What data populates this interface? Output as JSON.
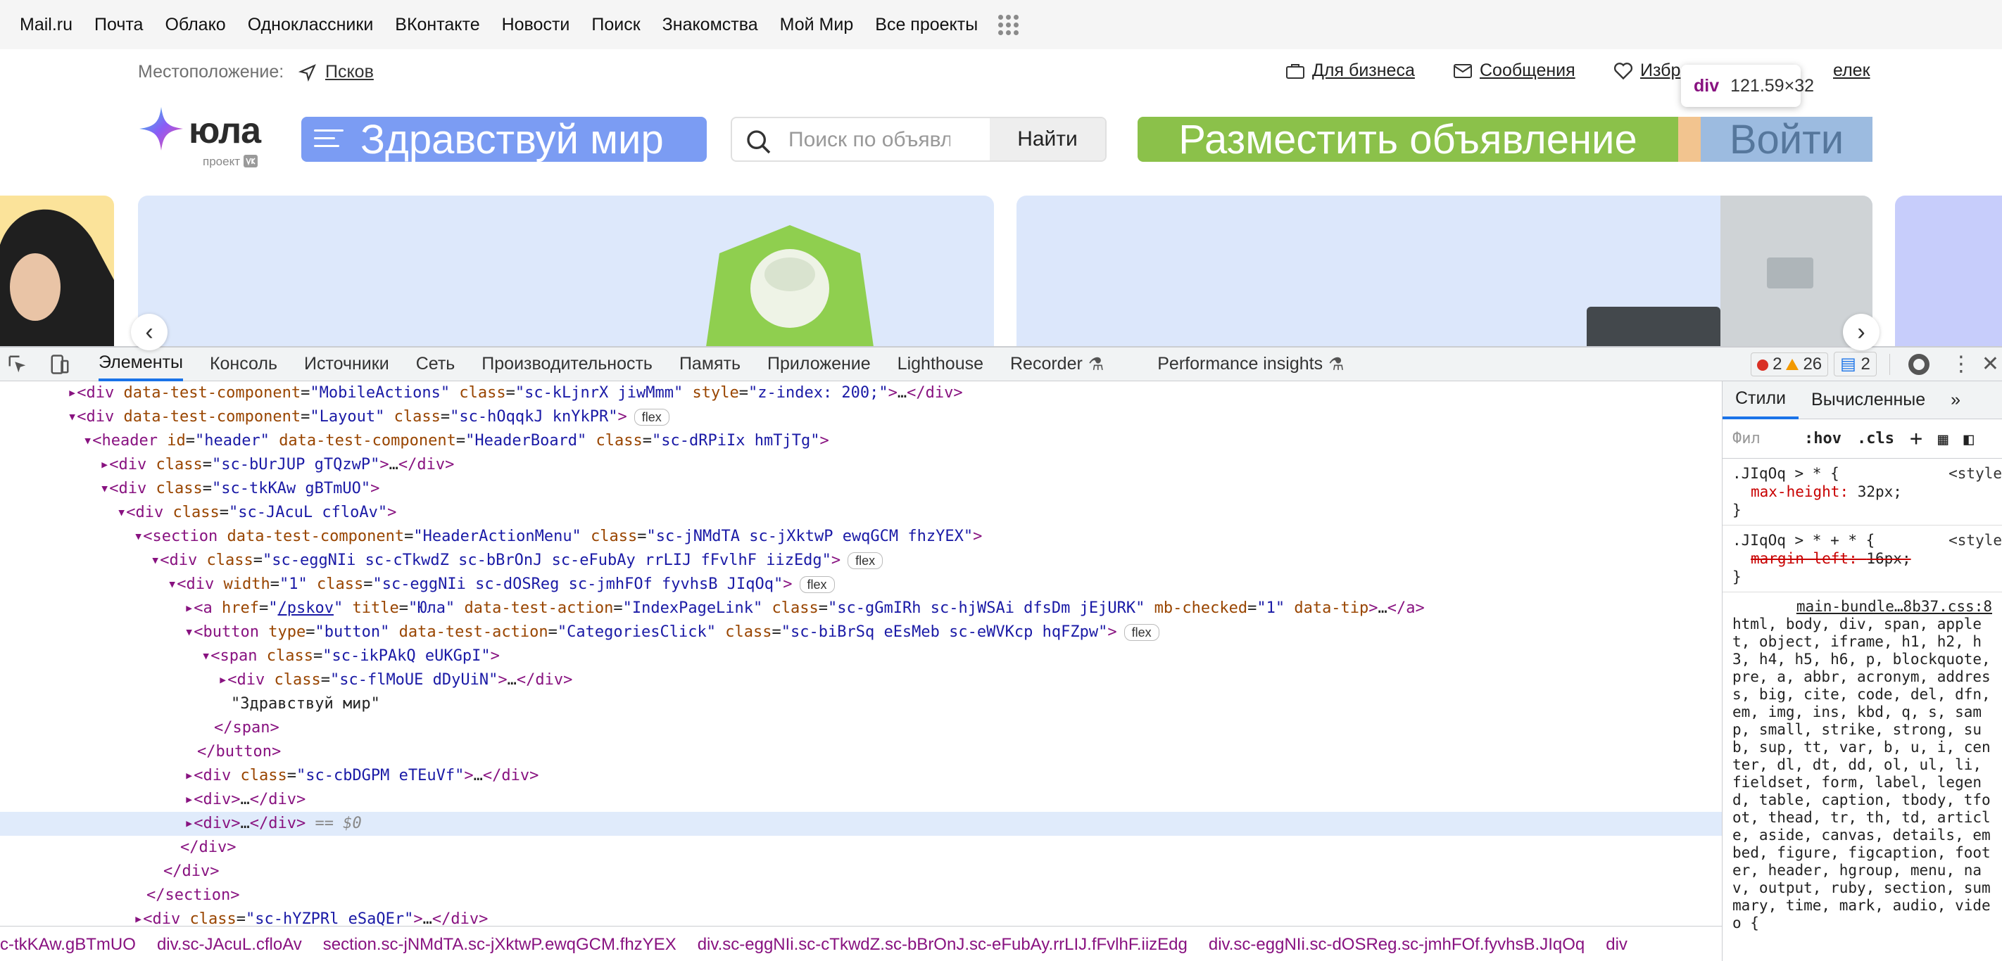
{
  "portal": {
    "links": [
      "Mail.ru",
      "Почта",
      "Облако",
      "Одноклассники",
      "ВКонтакте",
      "Новости",
      "Поиск",
      "Знакомства",
      "Мой Мир",
      "Все проекты"
    ]
  },
  "location": {
    "label": "Местоположение:",
    "city": "Псков"
  },
  "toplinks": {
    "business": "Для бизнеса",
    "messages": "Сообщения",
    "favorites": "Избр",
    "wallet": "елек"
  },
  "tooltip": {
    "tag": "div",
    "size": "121.59×32"
  },
  "header": {
    "logo": "юла",
    "logo_sub": "проект",
    "category_button": "Здравствуй мир",
    "search_placeholder": "Поиск по объявл",
    "search_button": "Найти",
    "post_button": "Разместить объявление",
    "login_button": "Войти"
  },
  "devtools": {
    "tabs": [
      "Элементы",
      "Консоль",
      "Источники",
      "Сеть",
      "Производительность",
      "Память",
      "Приложение",
      "Lighthouse",
      "Recorder",
      "Performance insights"
    ],
    "errors": "2",
    "warnings": "26",
    "messages": "2",
    "side_tabs": [
      "Стили",
      "Вычисленные"
    ],
    "filter": {
      "placeholder": "Фил",
      "hov": ":hov",
      "cls": ".cls"
    },
    "rules": [
      {
        "selector": ".JIqOq > * {",
        "src": "<style",
        "prop": "max-height",
        "value": "32px;"
      },
      {
        "selector": ".JIqOq > * + * {",
        "src": "<style",
        "prop": "margin-left",
        "value": "16px;"
      }
    ],
    "inherited_src": "main-bundle…8b37.css:8",
    "inherited_text": "html, body, div, span, applet, object, iframe, h1, h2, h3, h4, h5, h6, p, blockquote, pre, a, abbr, acronym, address, big, cite, code, del, dfn, em, img, ins, kbd, q, s, samp, small, strike, strong, sub, sup, tt, var, b, u, i, center, dl, dt, dd, ol, ul, li, fieldset, form, label, legend, table, caption, tbody, tfoot, thead, tr, th, td, article, aside, canvas, details, embed, figure, figcaption, footer, header, hgroup, menu, nav, output, ruby, section, summary, time, mark, audio, video {",
    "crumbs": [
      "c-tkKAw.gBTmUO",
      "div.sc-JAcuL.cfloAv",
      "section.sc-jNMdTA.sc-jXktwP.ewqGCM.fhzYEX",
      "div.sc-eggNIi.sc-cTkwdZ.sc-bBrOnJ.sc-eFubAy.rrLIJ.fFvlhF.iizEdg",
      "div.sc-eggNIi.sc-dOSReg.sc-jmhFOf.fyvhsB.JIqOq",
      "div"
    ]
  }
}
